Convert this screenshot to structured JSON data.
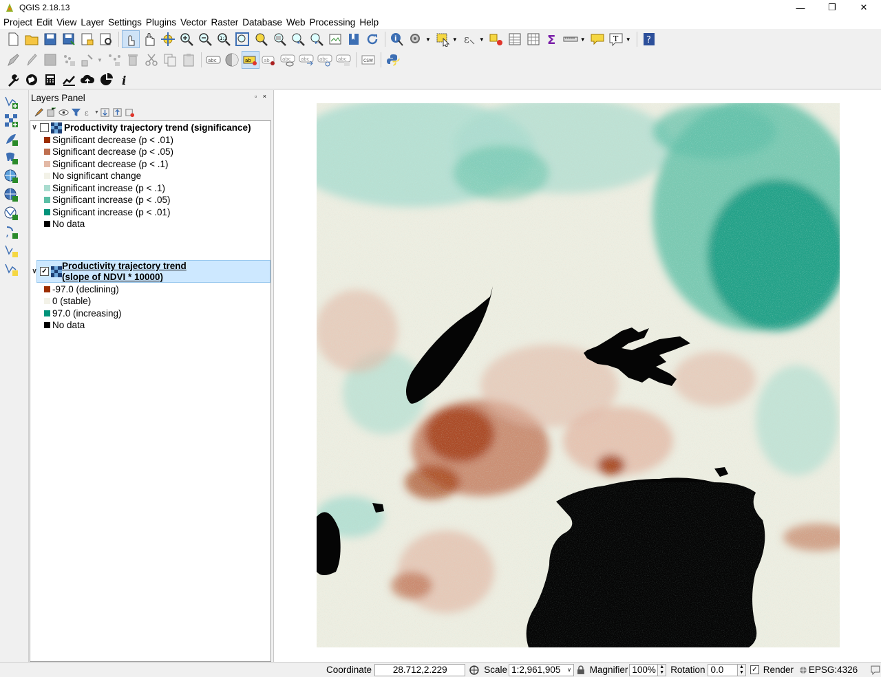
{
  "app": {
    "title": "QGIS 2.18.13",
    "window_controls": [
      "—",
      "❐",
      "✕"
    ]
  },
  "menu": [
    "Project",
    "Edit",
    "View",
    "Layer",
    "Settings",
    "Plugins",
    "Vector",
    "Raster",
    "Database",
    "Web",
    "Processing",
    "Help"
  ],
  "layers_panel": {
    "title": "Layers Panel",
    "layers": [
      {
        "name": "Productivity trajectory trend (significance)",
        "checked": false,
        "expanded": true,
        "legend": [
          {
            "label": "Significant decrease (p < .01)",
            "color": "#9c2e00"
          },
          {
            "label": "Significant decrease (p < .05)",
            "color": "#bf6f50"
          },
          {
            "label": "Significant decrease (p < .1)",
            "color": "#e3b9a6"
          },
          {
            "label": "No significant change",
            "color": "#f3f2e8"
          },
          {
            "label": "Significant increase (p < .1)",
            "color": "#a9dccf"
          },
          {
            "label": "Significant increase (p < .05)",
            "color": "#5cbfa6"
          },
          {
            "label": "Significant increase (p < .01)",
            "color": "#01937a"
          },
          {
            "label": "No data",
            "color": "#000000"
          }
        ]
      },
      {
        "name_line1": "Productivity trajectory trend",
        "name_line2": "(slope of NDVI * 10000)",
        "checked": true,
        "expanded": true,
        "selected": true,
        "legend": [
          {
            "label": "-97.0 (declining)",
            "color": "#9c2e00"
          },
          {
            "label": "0 (stable)",
            "color": "#f3f2e8"
          },
          {
            "label": "97.0 (increasing)",
            "color": "#01937a"
          },
          {
            "label": "No data",
            "color": "#000000"
          }
        ]
      }
    ]
  },
  "status": {
    "coordinate_label": "Coordinate",
    "coordinate_value": "28.712,2.229",
    "scale_label": "Scale",
    "scale_value": "1:2,961,905",
    "magnifier_label": "Magnifier",
    "magnifier_value": "100%",
    "rotation_label": "Rotation",
    "rotation_value": "0.0",
    "render_label": "Render",
    "render_checked": true,
    "crs": "EPSG:4326"
  },
  "map_colors": {
    "stable": "#f3f2e8",
    "increase_light": "#a9dccf",
    "increase_mid": "#5cbfa6",
    "increase_strong": "#01937a",
    "decrease_light": "#e3b9a6",
    "decrease_mid": "#bf6f50",
    "decrease_strong": "#9c2e00",
    "nodata": "#000000"
  }
}
